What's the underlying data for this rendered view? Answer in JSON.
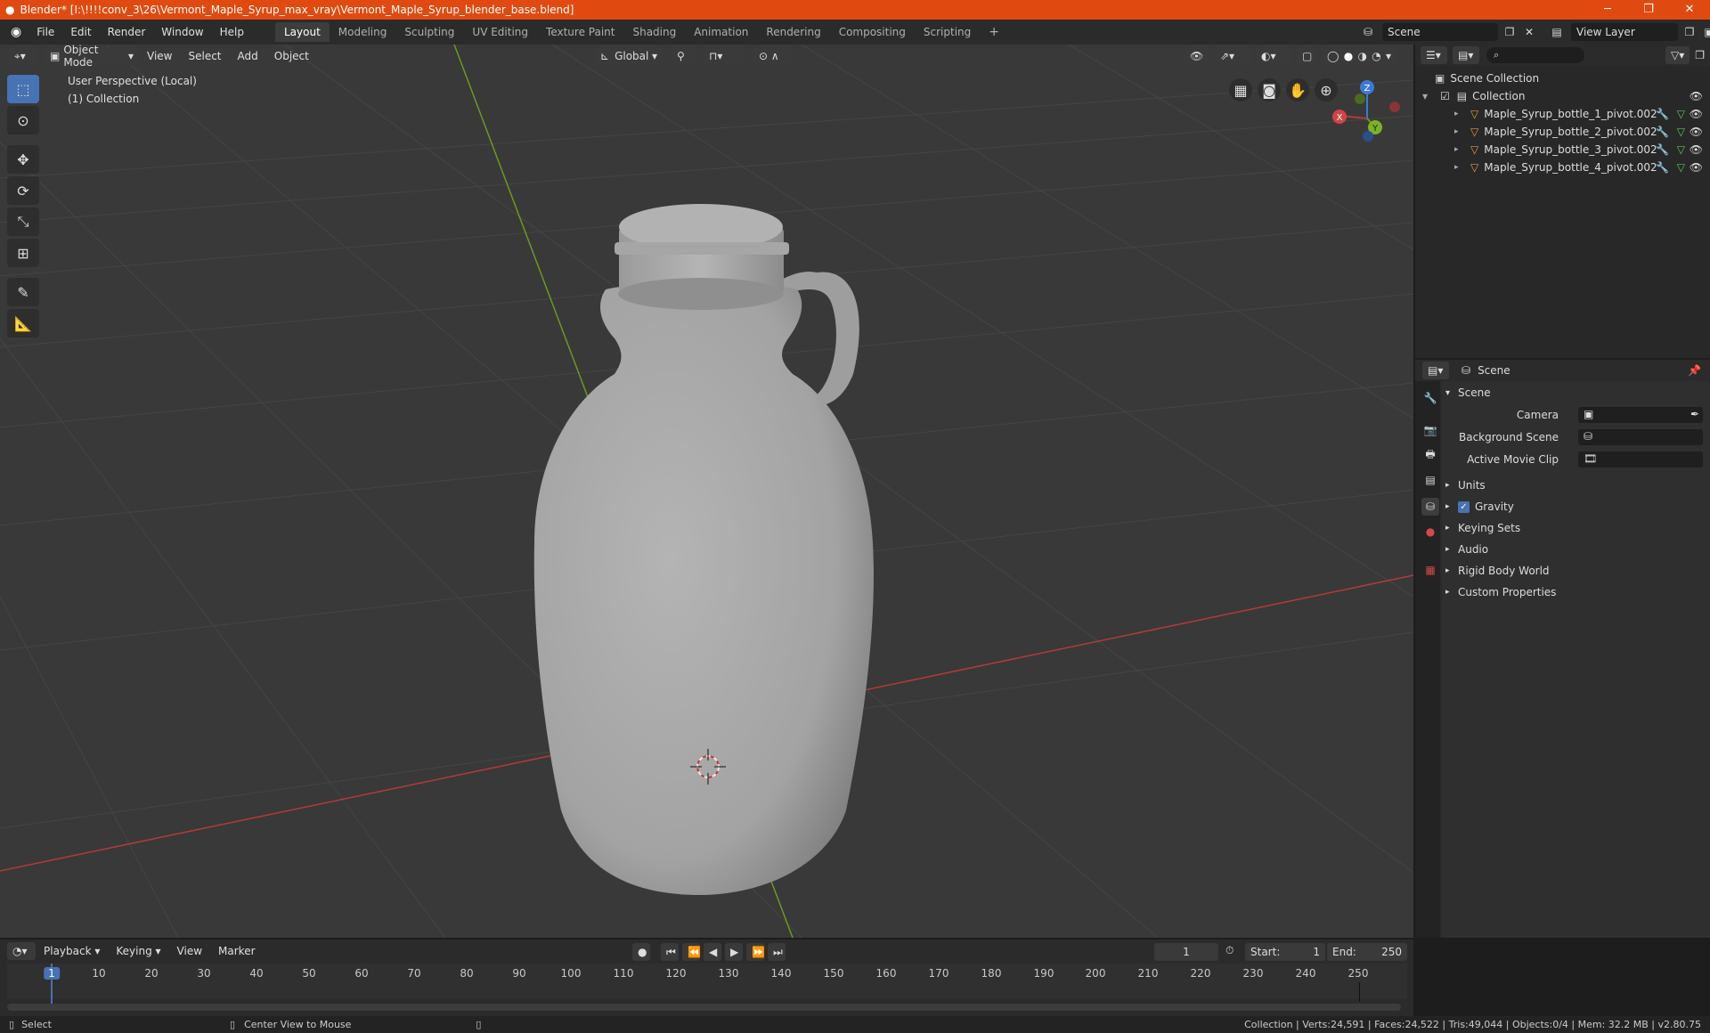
{
  "window": {
    "title": "Blender* [I:\\!!!!conv_3\\26\\Vermont_Maple_Syrup_max_vray\\Vermont_Maple_Syrup_blender_base.blend]"
  },
  "menu": {
    "file": "File",
    "edit": "Edit",
    "render": "Render",
    "window": "Window",
    "help": "Help"
  },
  "workspaces": [
    "Layout",
    "Modeling",
    "Sculpting",
    "UV Editing",
    "Texture Paint",
    "Shading",
    "Animation",
    "Rendering",
    "Compositing",
    "Scripting"
  ],
  "scene_selector": {
    "scene": "Scene",
    "view_layer": "View Layer"
  },
  "viewport": {
    "mode": "Object Mode",
    "view": "View",
    "select": "Select",
    "add": "Add",
    "object": "Object",
    "orientation": "Global",
    "overlay_line1": "User Perspective (Local)",
    "overlay_line2": "(1) Collection",
    "gizmo": {
      "x": "X",
      "y": "Y",
      "z": "Z"
    }
  },
  "outliner": {
    "root": "Scene Collection",
    "collection": "Collection",
    "items": [
      "Maple_Syrup_bottle_1_pivot.002",
      "Maple_Syrup_bottle_2_pivot.002",
      "Maple_Syrup_bottle_3_pivot.002",
      "Maple_Syrup_bottle_4_pivot.002"
    ]
  },
  "properties": {
    "header": "Scene",
    "section": "Scene",
    "camera_label": "Camera",
    "background_scene_label": "Background Scene",
    "active_movie_clip_label": "Active Movie Clip",
    "panels": [
      "Units",
      "Gravity",
      "Keying Sets",
      "Audio",
      "Rigid Body World",
      "Custom Properties"
    ],
    "gravity_checked": true
  },
  "timeline": {
    "playback": "Playback",
    "keying": "Keying",
    "view": "View",
    "marker": "Marker",
    "current_frame": "1",
    "start_label": "Start:",
    "start": "1",
    "end_label": "End:",
    "end": "250",
    "ticks": [
      "1",
      "10",
      "20",
      "30",
      "40",
      "50",
      "60",
      "70",
      "80",
      "90",
      "100",
      "110",
      "120",
      "130",
      "140",
      "150",
      "160",
      "170",
      "180",
      "190",
      "200",
      "210",
      "220",
      "230",
      "240",
      "250"
    ]
  },
  "status": {
    "select": "Select",
    "center_view": "Center View to Mouse",
    "stats": "Collection | Verts:24,591 | Faces:24,522 | Tris:49,044 | Objects:0/4 | Mem: 32.2 MB | v2.80.75"
  },
  "colors": {
    "title_bar": "#e04a10",
    "accent": "#4772b3",
    "viewport_bg": "#393939",
    "x_axis": "#b33a3a",
    "y_axis": "#6a9a1f",
    "z_axis": "#3a7ad6"
  }
}
